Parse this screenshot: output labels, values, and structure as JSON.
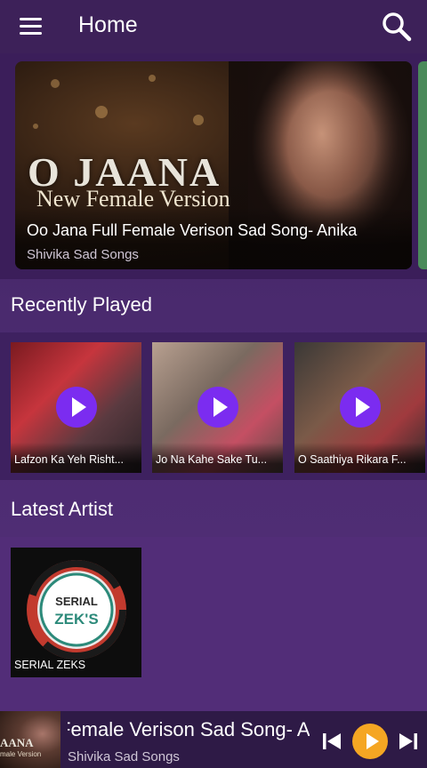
{
  "header": {
    "title": "Home",
    "menu_icon": "hamburger-menu-icon",
    "search_icon": "search-icon"
  },
  "featured": {
    "artwork_title": "O JAANA",
    "artwork_subtitle": "New Female Version",
    "title": "Oo Jana Full Female Verison Sad Song- Anika",
    "artist": "Shivika Sad Songs"
  },
  "sections": {
    "recently_played": "Recently Played",
    "latest_artist": "Latest Artist"
  },
  "recently_played": [
    {
      "label": "Lafzon Ka Yeh Risht..."
    },
    {
      "label": "Jo Na Kahe Sake Tu..."
    },
    {
      "label": "O Saathiya Rikara F..."
    }
  ],
  "latest_artists": [
    {
      "label": "SERIAL ZEKS",
      "logo_line1": "SERIAL",
      "logo_line2": "ZEK'S"
    }
  ],
  "player": {
    "thumb_line1": "AANA",
    "thumb_line2": "male Version",
    "title": "Female Verison Sad Song- Anika",
    "artist": "Shivika Sad Songs",
    "accent": "#f5a623"
  },
  "colors": {
    "background": "#4a2a6e",
    "play_overlay": "#7b2cf0"
  }
}
